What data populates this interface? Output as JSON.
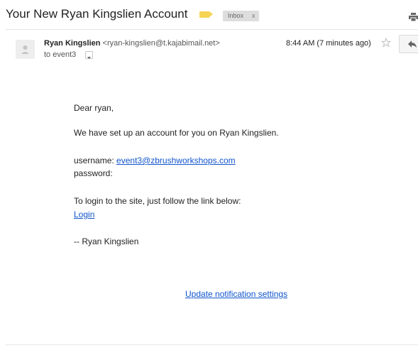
{
  "email": {
    "subject": "Your New Ryan Kingslien Account",
    "label_color": "#f6d353",
    "labels": [
      {
        "name": "Inbox",
        "remove": "x"
      }
    ],
    "sender_name": "Ryan Kingslien",
    "sender_email": "<ryan-kingslien@t.kajabimail.net>",
    "recipient": "to event3",
    "time": "8:44 AM (7 minutes ago)",
    "icons": [
      "label-tag-icon",
      "print-icon",
      "avatar-icon",
      "chevron-down-icon",
      "star-icon",
      "reply-icon"
    ]
  },
  "body": {
    "greeting": "Dear ryan,",
    "intro": "We have set up an account for you on Ryan Kingslien.",
    "username_label": "username:",
    "username_value": "event3@zbrushworkshops.com",
    "password_label": "password:",
    "login_instructions": "To login to the site, just follow the link below:",
    "login_link": "Login",
    "signature": "-- Ryan Kingslien"
  },
  "footer": {
    "settings_link": "Update notification settings"
  },
  "colors": {
    "link": "#1155cc",
    "chip_bg": "#dddddd"
  }
}
